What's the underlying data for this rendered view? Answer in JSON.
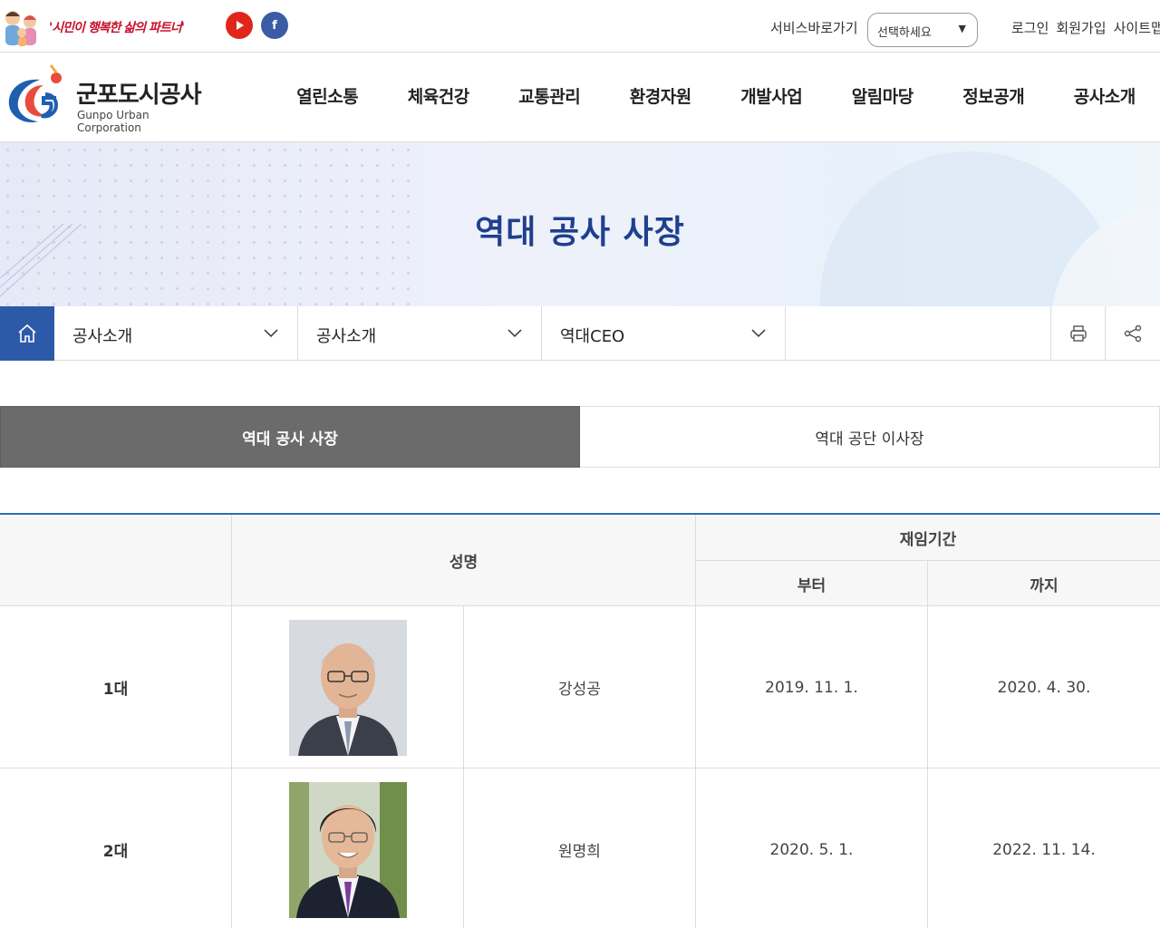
{
  "topbar": {
    "slogan": "'시민이 행복한 삶의 파트너'",
    "youtube_icon": "youtube-icon",
    "facebook_icon": "facebook-icon",
    "service_shortcut_label": "서비스바로가기",
    "service_select_value": "선택하세요",
    "links": [
      "로그인",
      "회원가입",
      "사이트맵"
    ]
  },
  "header": {
    "logo_ko": "군포도시공사",
    "logo_en": "Gunpo Urban Corporation",
    "gnb": [
      "열린소통",
      "체육건강",
      "교통관리",
      "환경자원",
      "개발사업",
      "알림마당",
      "정보공개",
      "공사소개"
    ]
  },
  "visual": {
    "title": "역대 공사 사장"
  },
  "location": {
    "home_icon": "home-icon",
    "depth1": "공사소개",
    "depth2": "공사소개",
    "depth3": "역대CEO",
    "print_icon": "print-icon",
    "share_icon": "share-icon"
  },
  "tabs": [
    {
      "label": "역대 공사 사장",
      "active": true
    },
    {
      "label": "역대 공단 이사장",
      "active": false
    }
  ],
  "table": {
    "headers": {
      "name": "성명",
      "period": "재임기간",
      "from": "부터",
      "to": "까지"
    },
    "rows": [
      {
        "order": "1대",
        "name": "강성공",
        "from": "2019. 11. 1.",
        "to": "2020. 4. 30."
      },
      {
        "order": "2대",
        "name": "원명희",
        "from": "2020. 5. 1.",
        "to": "2022. 11. 14."
      }
    ]
  },
  "colors": {
    "brand_blue": "#2d5aa8",
    "title_blue": "#1f3f8f",
    "active_tab": "#6b6b6b",
    "table_top_border": "#2d6cb5"
  }
}
